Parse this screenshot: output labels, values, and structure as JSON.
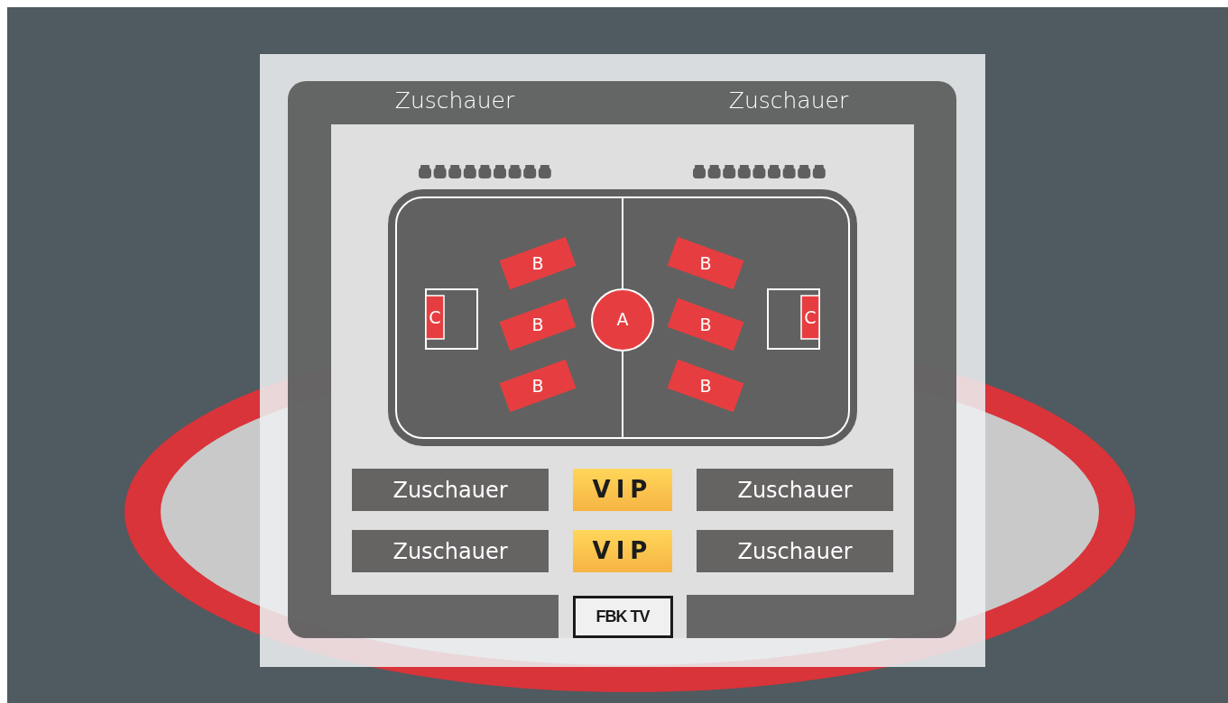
{
  "top_labels": [
    "Zuschauer",
    "Zuschauer"
  ],
  "court": {
    "center": "A",
    "zones": [
      {
        "label": "B"
      },
      {
        "label": "B"
      },
      {
        "label": "B"
      },
      {
        "label": "B"
      },
      {
        "label": "B"
      },
      {
        "label": "B"
      }
    ],
    "goals": [
      "C",
      "C"
    ]
  },
  "stands": [
    {
      "left": "Zuschauer",
      "center": "VIP",
      "right": "Zuschauer"
    },
    {
      "left": "Zuschauer",
      "center": "VIP",
      "right": "Zuschauer"
    }
  ],
  "tv": "FBK TV"
}
